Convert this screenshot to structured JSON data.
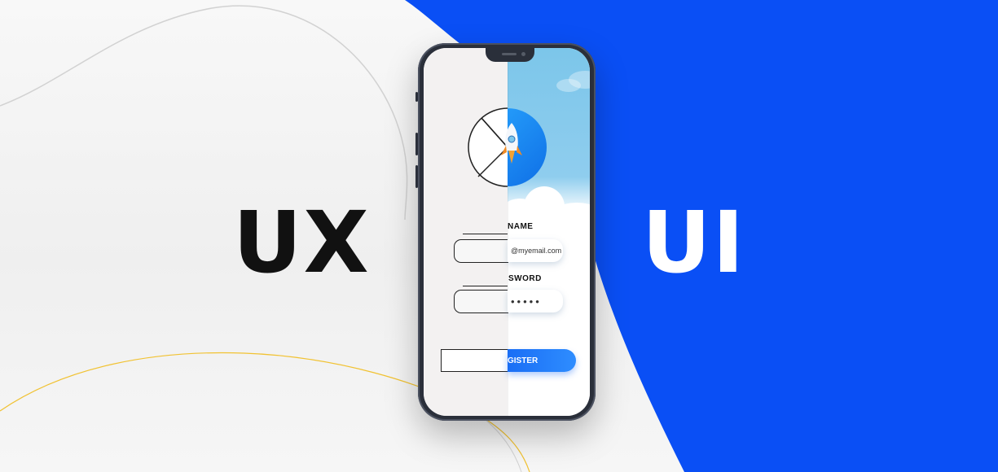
{
  "labels": {
    "ux": "UX",
    "ui": "UI"
  },
  "phone": {
    "name_label": "NAME",
    "email_value": "@myemail.com",
    "password_label": "SWORD",
    "password_dots": "•••••",
    "button_label": "GISTER"
  },
  "colors": {
    "brand_blue": "#0a4ff5",
    "button_blue": "#1a6ef5",
    "sky_blue": "#7cc6ea",
    "phone_frame": "#2a2f3a",
    "text_dark": "#111111"
  },
  "icons": [
    "rocket-icon",
    "pie-wireframe-icon"
  ]
}
